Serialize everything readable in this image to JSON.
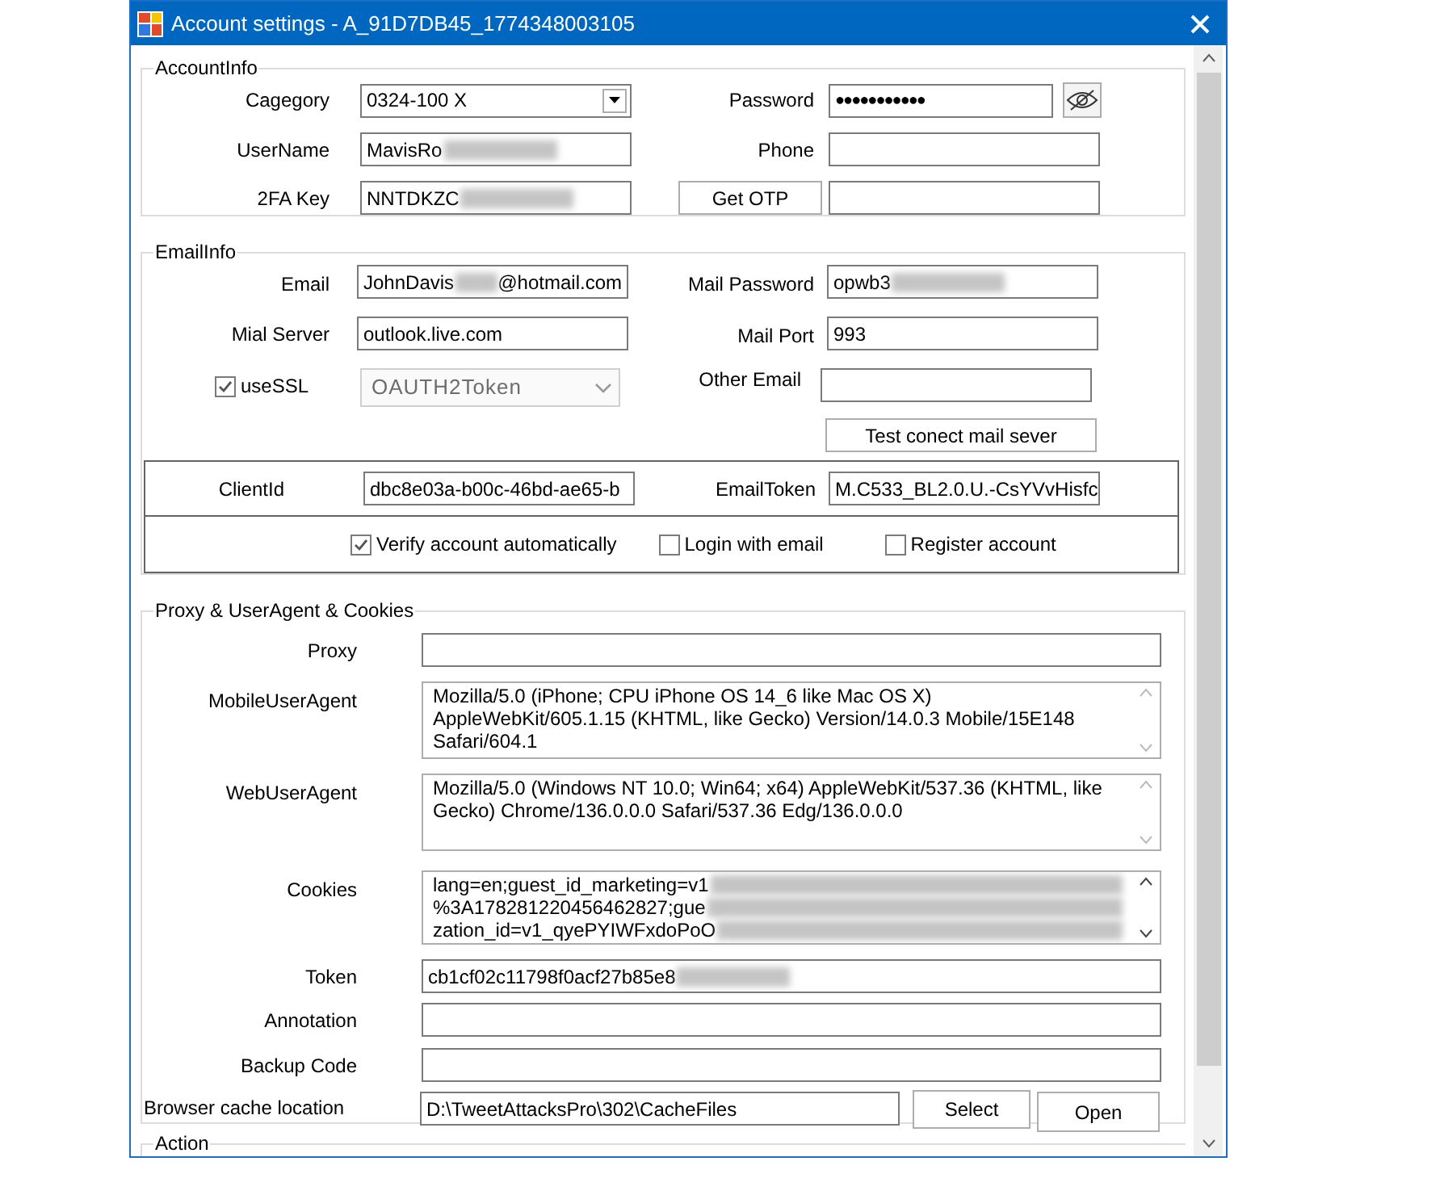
{
  "window": {
    "title": "Account settings - A_91D7DB45_1774348003105"
  },
  "account_info": {
    "title": "AccountInfo",
    "category": {
      "label": "Cagegory",
      "value": "0324-100 X"
    },
    "password": {
      "label": "Password",
      "value": "●●●●●●●●●●●"
    },
    "username": {
      "label": "UserName",
      "value": "MavisRo",
      "blurred": true
    },
    "phone": {
      "label": "Phone"
    },
    "twofa_key": {
      "label": "2FA Key",
      "value": "NNTDKZC",
      "blurred": true
    },
    "get_otp_button": "Get OTP"
  },
  "email_info": {
    "title": "EmailInfo",
    "email": {
      "label": "Email",
      "value": "JohnDavis",
      "blurred": true,
      "suffix": "@hotmail.com"
    },
    "mail_password": {
      "label": "Mail Password",
      "value": "opwb3",
      "blurred": true
    },
    "mail_server": {
      "label": "Mial Server",
      "value": "outlook.live.com"
    },
    "mail_port": {
      "label": "Mail Port",
      "value": "993"
    },
    "use_ssl": {
      "label": "useSSL",
      "checked": true
    },
    "auth_type": {
      "value": "OAUTH2Token",
      "disabled": true
    },
    "other_email": {
      "label": "Other Email"
    },
    "test_button": "Test conect mail sever",
    "client_id": {
      "label": "ClientId",
      "value": "dbc8e03a-b00c-46bd-ae65-b"
    },
    "email_token": {
      "label": "EmailToken",
      "value": "M.C533_BL2.0.U.-CsYVvHisfc"
    },
    "options": [
      {
        "label": "Verify account automatically",
        "checked": true
      },
      {
        "label": "Login with email",
        "checked": false
      },
      {
        "label": "Register account",
        "checked": false
      }
    ]
  },
  "proxy_section": {
    "title": "Proxy & UserAgent & Cookies",
    "fields": [
      {
        "kind": "line",
        "label": "Proxy"
      },
      {
        "kind": "multiline",
        "label": "MobileUserAgent",
        "lines": [
          "Mozilla/5.0 (iPhone; CPU iPhone OS 14_6 like Mac OS X)",
          "AppleWebKit/605.1.15 (KHTML, like Gecko) Version/14.0.3 Mobile/15E148",
          "Safari/604.1"
        ]
      },
      {
        "kind": "multiline",
        "label": "WebUserAgent",
        "lines": [
          "Mozilla/5.0 (Windows NT 10.0; Win64; x64) AppleWebKit/537.36 (KHTML, like",
          "Gecko) Chrome/136.0.0.0 Safari/537.36 Edg/136.0.0.0"
        ]
      },
      {
        "kind": "multiline",
        "label": "Cookies",
        "blurred": true,
        "lines": [
          "lang=en;guest_id_marketing=v1",
          "%3A178281220456462827;gue",
          "zation_id=v1_qyePYIWFxdoPoO"
        ]
      },
      {
        "kind": "line",
        "label": "Token",
        "value": "cb1cf02c11798f0acf27b85e8",
        "blurred": true
      },
      {
        "kind": "line",
        "label": "Annotation"
      },
      {
        "kind": "line",
        "label": "Backup Code"
      }
    ],
    "browser_cache": {
      "label": "Browser cache location",
      "value": "D:\\TweetAttacksPro\\302\\CacheFiles",
      "buttons": [
        "Select",
        "Open"
      ]
    }
  },
  "action_section": {
    "title": "Action"
  }
}
